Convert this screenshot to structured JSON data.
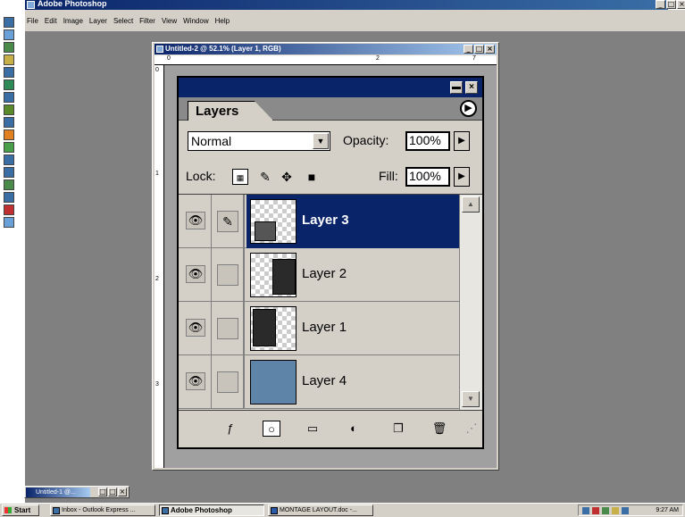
{
  "app": {
    "title": "Adobe Photoshop",
    "menu": [
      "File",
      "Edit",
      "Image",
      "Layer",
      "Select",
      "Filter",
      "View",
      "Window",
      "Help"
    ],
    "window_controls": [
      "_",
      "×"
    ]
  },
  "document": {
    "title": "Untitled-2 @ 52.1% (Layer 1, RGB)",
    "ruler_h_labels": [
      "0",
      "2",
      "7"
    ],
    "ruler_v_labels": [
      "0",
      "1",
      "2",
      "3"
    ]
  },
  "layers_palette": {
    "tab_label": "Layers",
    "blend_mode": "Normal",
    "opacity_label": "Opacity:",
    "opacity_value": "100%",
    "lock_label": "Lock:",
    "fill_label": "Fill:",
    "fill_value": "100%",
    "layers": [
      {
        "name": "Layer 3",
        "selected": true,
        "thumb": "photo-small"
      },
      {
        "name": "Layer 2",
        "selected": false,
        "thumb": "photo-right"
      },
      {
        "name": "Layer 1",
        "selected": false,
        "thumb": "photo-left"
      },
      {
        "name": "Layer 4",
        "selected": false,
        "thumb": "blue-texture"
      }
    ],
    "bottom_icons": [
      "layer-style-icon",
      "mask-icon",
      "new-set-icon",
      "adjustment-layer-icon",
      "new-layer-icon",
      "trash-icon"
    ]
  },
  "minimized_window": {
    "title": "Untitled-1 @..."
  },
  "taskbar": {
    "start_label": "Start",
    "tasks": [
      {
        "label": "Inbox - Outlook Express ...",
        "active": false
      },
      {
        "label": "Adobe Photoshop",
        "active": true
      },
      {
        "label": "MONTAGE LAYOUT.doc -...",
        "active": false
      }
    ],
    "clock": "9:27 AM"
  },
  "colors": {
    "selection": "#0a246a",
    "face": "#d4d0c8",
    "desktop": "#808080"
  }
}
